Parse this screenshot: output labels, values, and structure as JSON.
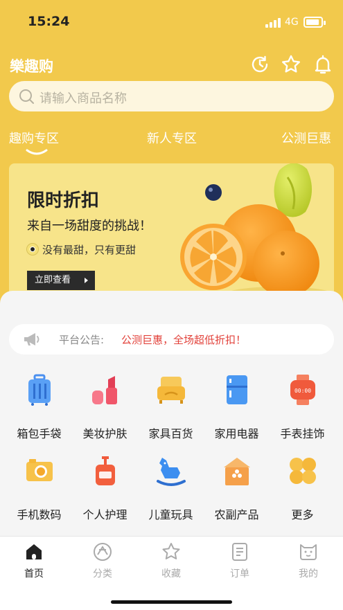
{
  "status_bar": {
    "time": "15:24",
    "network": "4G"
  },
  "header": {
    "brand": "樂趣购",
    "icons": [
      "history-icon",
      "star-icon",
      "bell-icon"
    ]
  },
  "search": {
    "placeholder": "请输入商品名称"
  },
  "tabs": [
    {
      "label": "趣购专区",
      "active": true
    },
    {
      "label": "新人专区",
      "active": false
    },
    {
      "label": "公测巨惠",
      "active": false
    }
  ],
  "banner": {
    "title": "限时折扣",
    "subtitle": "来自一场甜度的挑战！",
    "motto": "没有最甜，只有更甜",
    "cta": "立即查看"
  },
  "notice": {
    "label": "平台公告:",
    "message": "公测巨惠，全场超低折扣！"
  },
  "categories": [
    {
      "label": "箱包手袋",
      "icon": "luggage-icon",
      "color": "#4a90f0"
    },
    {
      "label": "美妆护肤",
      "icon": "lipstick-icon",
      "color": "#f0566a"
    },
    {
      "label": "家具百货",
      "icon": "sofa-icon",
      "color": "#f5b83a"
    },
    {
      "label": "家用电器",
      "icon": "fridge-icon",
      "color": "#3c8ef0"
    },
    {
      "label": "手表挂饰",
      "icon": "watch-icon",
      "color": "#f05a3c"
    },
    {
      "label": "手机数码",
      "icon": "camera-icon",
      "color": "#f5b83a"
    },
    {
      "label": "个人护理",
      "icon": "lotion-icon",
      "color": "#f05a3c"
    },
    {
      "label": "儿童玩具",
      "icon": "rocking-horse-icon",
      "color": "#3c8ef0"
    },
    {
      "label": "农副产品",
      "icon": "granary-icon",
      "color": "#f5a04a"
    },
    {
      "label": "更多",
      "icon": "more-grid-icon",
      "color": "#f5b83a"
    }
  ],
  "tabbar": [
    {
      "label": "首页",
      "icon": "home-icon",
      "active": true
    },
    {
      "label": "分类",
      "icon": "category-icon",
      "active": false
    },
    {
      "label": "收藏",
      "icon": "star-icon",
      "active": false
    },
    {
      "label": "订单",
      "icon": "order-icon",
      "active": false
    },
    {
      "label": "我的",
      "icon": "profile-icon",
      "active": false
    }
  ],
  "colors": {
    "brand_yellow": "#f2c94c",
    "notice_red": "#e2413a"
  }
}
